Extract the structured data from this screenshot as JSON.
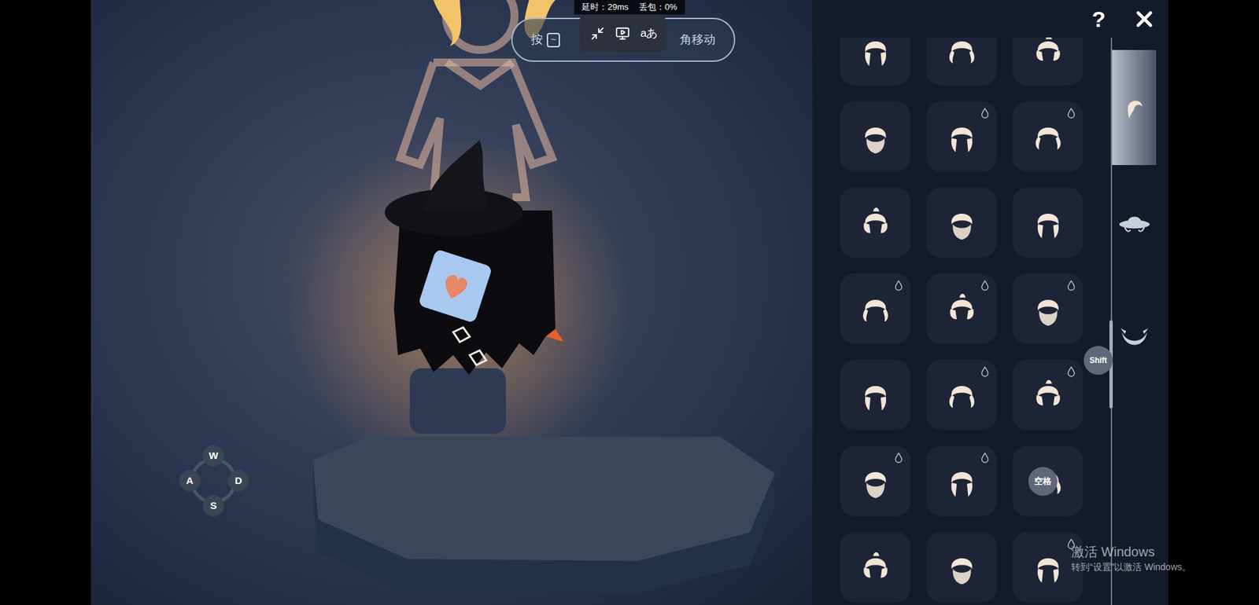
{
  "overlay": {
    "latency": "延时：29ms",
    "packet_loss": "丢包：0%",
    "hint_prefix": "按",
    "hint_key": "~",
    "hint_suffix": "角移动",
    "translate": "aあ"
  },
  "keys": {
    "movement": [
      "W",
      "A",
      "S",
      "D"
    ],
    "shift": "Shift",
    "space": "空格"
  },
  "panel": {
    "help": "?",
    "tabs": [
      {
        "kind": "hair",
        "selected": true
      },
      {
        "kind": "hat",
        "selected": false
      },
      {
        "kind": "horns",
        "selected": false
      }
    ],
    "scroll": {
      "level": 0.59
    },
    "items": [
      {
        "dyeable": false
      },
      {
        "dyeable": false
      },
      {
        "dyeable": false
      },
      {
        "dyeable": false
      },
      {
        "dyeable": true
      },
      {
        "dyeable": true
      },
      {
        "dyeable": false
      },
      {
        "dyeable": false
      },
      {
        "dyeable": false
      },
      {
        "dyeable": true
      },
      {
        "dyeable": true
      },
      {
        "dyeable": true
      },
      {
        "dyeable": false
      },
      {
        "dyeable": true
      },
      {
        "dyeable": true
      },
      {
        "dyeable": true
      },
      {
        "dyeable": true
      },
      {
        "dyeable": false
      },
      {
        "dyeable": false
      },
      {
        "dyeable": false
      },
      {
        "dyeable": true
      }
    ]
  },
  "watermark": {
    "title": "激活 Windows",
    "subtitle": "转到“设置”以激活 Windows。"
  }
}
